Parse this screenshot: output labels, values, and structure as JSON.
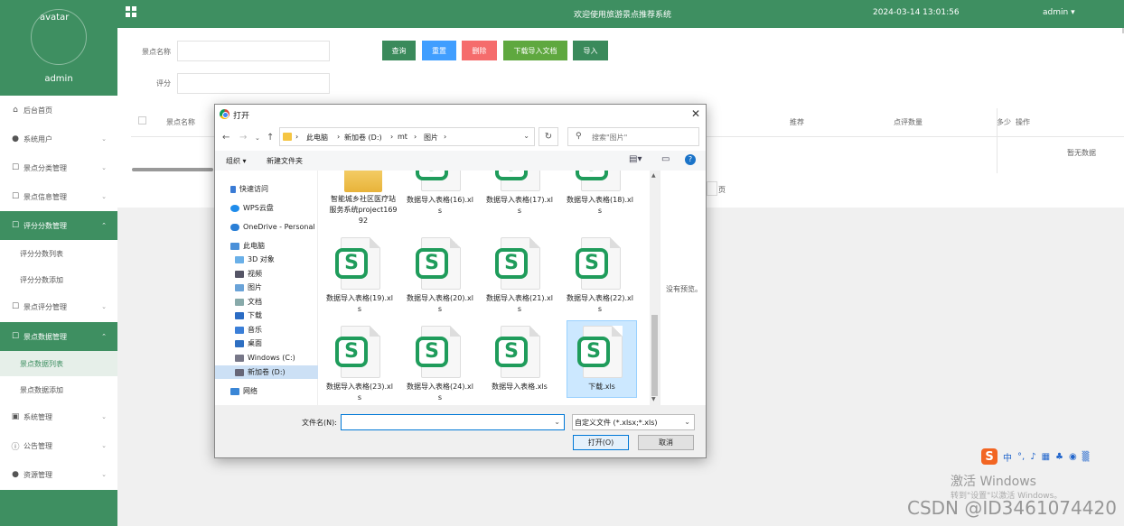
{
  "sidebar": {
    "avatar_alt": "avatar",
    "username": "admin",
    "items": [
      {
        "label": "后台首页",
        "icon": "home-icon"
      },
      {
        "label": "系统用户",
        "icon": "user-icon"
      },
      {
        "label": "景点分类管理",
        "icon": "edit-icon"
      },
      {
        "label": "景点信息管理",
        "icon": "edit-icon"
      },
      {
        "label": "评分分数管理",
        "icon": "edit-icon",
        "active": true,
        "expanded": true
      },
      {
        "label": "景点评分管理",
        "icon": "edit-icon"
      },
      {
        "label": "景点数据管理",
        "icon": "edit-icon",
        "active": true,
        "expanded": true
      },
      {
        "label": "系统管理",
        "icon": "image-icon"
      },
      {
        "label": "公告管理",
        "icon": "info-icon"
      },
      {
        "label": "资源管理",
        "icon": "location-icon"
      }
    ],
    "subitems_score": [
      "评分分数列表",
      "评分分数添加"
    ],
    "subitems_data": [
      "景点数据列表",
      "景点数据添加"
    ]
  },
  "header": {
    "title": "欢迎使用旅游景点推荐系统",
    "datetime": "2024-03-14 13:01:56",
    "user": "admin",
    "user_caret": "▾"
  },
  "filters": {
    "name_label": "景点名称",
    "score_label": "评分"
  },
  "toolbar": {
    "query": "查询",
    "reset": "重置",
    "delete": "删除",
    "download_template": "下载导入文档",
    "import": "导入"
  },
  "colors": {
    "brand": "#3e8f61",
    "query_btn": "#3a8a5b",
    "reset_btn": "#409eff",
    "delete_btn": "#f56c6c",
    "download_btn": "#5fa83f",
    "import_btn": "#3a8a5b"
  },
  "table": {
    "columns": [
      "景点名称",
      "推荐",
      "点评数量",
      "多少",
      "操作"
    ],
    "empty_text": "暂无数据",
    "pager_suffix": "页"
  },
  "dialog": {
    "title": "打开",
    "close": "✕",
    "breadcrumbs": [
      "此电脑",
      "新加卷 (D:)",
      "mt",
      "图片"
    ],
    "search_placeholder": "搜索\"图片\"",
    "organize": "组织 ▾",
    "new_folder": "新建文件夹",
    "nav_items": [
      {
        "label": "快速访问",
        "icon": "pin-icon"
      },
      {
        "label": "WPS云盘",
        "icon": "cloud-icon"
      },
      {
        "label": "OneDrive - Personal",
        "icon": "onedrive-icon"
      },
      {
        "label": "此电脑",
        "icon": "pc-icon"
      },
      {
        "label": "3D 对象",
        "icon": "cube-icon"
      },
      {
        "label": "视频",
        "icon": "video-icon"
      },
      {
        "label": "图片",
        "icon": "picture-icon"
      },
      {
        "label": "文档",
        "icon": "document-icon"
      },
      {
        "label": "下载",
        "icon": "download-icon"
      },
      {
        "label": "音乐",
        "icon": "music-icon"
      },
      {
        "label": "桌面",
        "icon": "desktop-icon"
      },
      {
        "label": "Windows (C:)",
        "icon": "drive-icon"
      },
      {
        "label": "新加卷 (D:)",
        "icon": "drive-icon",
        "selected": true
      },
      {
        "label": "网络",
        "icon": "network-icon"
      }
    ],
    "files": [
      {
        "name": "智能城乡社区医疗站服务系统project16992",
        "type": "folder"
      },
      {
        "name": "数据导入表格(16).xls",
        "type": "xls"
      },
      {
        "name": "数据导入表格(17).xls",
        "type": "xls"
      },
      {
        "name": "数据导入表格(18).xls",
        "type": "xls"
      },
      {
        "name": "数据导入表格(19).xls",
        "type": "xls"
      },
      {
        "name": "数据导入表格(20).xls",
        "type": "xls"
      },
      {
        "name": "数据导入表格(21).xls",
        "type": "xls"
      },
      {
        "name": "数据导入表格(22).xls",
        "type": "xls"
      },
      {
        "name": "数据导入表格(23).xls",
        "type": "xls"
      },
      {
        "name": "数据导入表格(24).xls",
        "type": "xls"
      },
      {
        "name": "数据导入表格.xls",
        "type": "xls"
      },
      {
        "name": "下载.xls",
        "type": "xls",
        "selected": true
      }
    ],
    "no_preview": "没有预览。",
    "filename_label": "文件名(N):",
    "filename_value": "",
    "filetype": "自定义文件 (*.xlsx;*.xls)",
    "open_btn": "打开(O)",
    "cancel_btn": "取消"
  },
  "ime": {
    "lang": "中"
  },
  "watermark": {
    "activate": "激活 Windows",
    "activate_sub": "转到\"设置\"以激活 Windows。",
    "csdn": "CSDN @ID3461074420"
  }
}
